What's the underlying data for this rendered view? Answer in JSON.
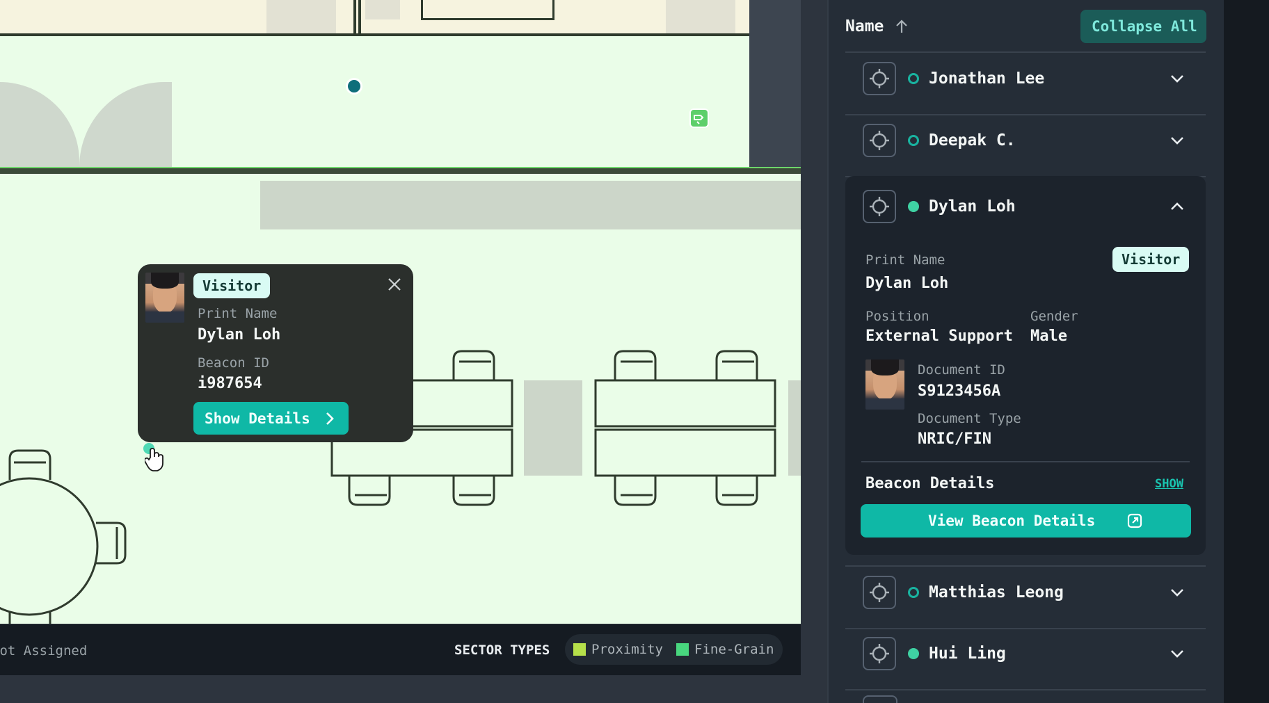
{
  "tooltip": {
    "badge": "Visitor",
    "print_name_label": "Print Name",
    "print_name": "Dylan Loh",
    "beacon_id_label": "Beacon ID",
    "beacon_id": "i987654",
    "show_details_label": "Show Details"
  },
  "legend": {
    "not_assigned": "Not Assigned",
    "sector_types_label": "SECTOR TYPES",
    "items": [
      {
        "label": "Proximity",
        "color": "#b6e04a"
      },
      {
        "label": "Fine-Grain",
        "color": "#48d67e"
      }
    ]
  },
  "panel": {
    "sort_label": "Name",
    "collapse_all_label": "Collapse All",
    "people": [
      {
        "name": "Jonathan Lee",
        "status": "outline"
      },
      {
        "name": "Deepak C.",
        "status": "outline"
      },
      {
        "name": "Dylan Loh",
        "status": "filled"
      },
      {
        "name": "Matthias Leong",
        "status": "outline"
      },
      {
        "name": "Hui Ling",
        "status": "filled"
      }
    ],
    "expanded": {
      "print_name_label": "Print Name",
      "print_name": "Dylan Loh",
      "badge": "Visitor",
      "position_label": "Position",
      "position": "External Support",
      "gender_label": "Gender",
      "gender": "Male",
      "document_id_label": "Document ID",
      "document_id": "S9123456A",
      "document_type_label": "Document Type",
      "document_type": "NRIC/FIN",
      "beacon_details_label": "Beacon Details",
      "show_link": "SHOW",
      "view_beacon_label": "View Beacon Details"
    }
  },
  "colors": {
    "accent": "#0fb8a6",
    "status_outline": "#19b3a0",
    "status_filled": "#3fd2a3"
  }
}
